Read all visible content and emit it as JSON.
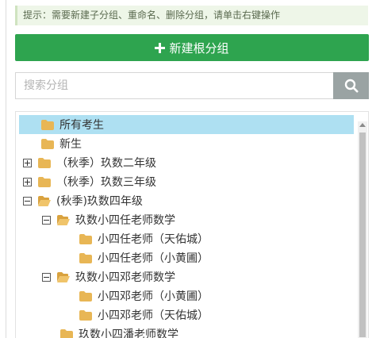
{
  "hint": {
    "text": "提示：需要新建子分组、重命名、删除分组，请单击右键操作"
  },
  "new_root_button": {
    "label": "新建根分组"
  },
  "search": {
    "placeholder": "搜索分组"
  },
  "tree": {
    "nodes": [
      {
        "label": "所有考生",
        "selected": true
      },
      {
        "label": "新生"
      },
      {
        "label": "（秋季）玖数二年级",
        "toggle": "expand"
      },
      {
        "label": "（秋季）玖数三年级",
        "toggle": "expand"
      },
      {
        "label": "(秋季)玖数四年级",
        "toggle": "collapse",
        "folder": "open"
      },
      {
        "label": "玖数小四任老师数学",
        "toggle": "collapse",
        "folder": "open"
      },
      {
        "label": "小四任老师（天佑城）"
      },
      {
        "label": "小四任老师（小黄圃）"
      },
      {
        "label": "玖数小四邓老师数学",
        "toggle": "collapse",
        "folder": "open"
      },
      {
        "label": "小四邓老师（小黄圃）"
      },
      {
        "label": "小四邓老师（天佑城）"
      },
      {
        "label": "玖数小四潘老师数学"
      }
    ]
  },
  "colors": {
    "accent_green": "#2ea44f",
    "selected_row": "#aee0f2",
    "folder": "#e8b655",
    "search_button": "#9aa3a3"
  },
  "icons": {
    "add": "plus-icon",
    "search": "search-icon",
    "folder_closed": "folder-icon",
    "folder_open": "folder-open-icon",
    "expand": "expand-icon",
    "collapse": "collapse-icon"
  }
}
